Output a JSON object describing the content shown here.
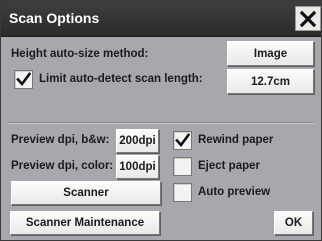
{
  "window": {
    "title": "Scan Options"
  },
  "height_autosize": {
    "label": "Height auto-size method:",
    "value": "Image"
  },
  "limit_scan_length": {
    "label": "Limit auto-detect scan length:",
    "checked": true,
    "value": "12.7cm"
  },
  "preview_dpi_bw": {
    "label": "Preview dpi, b&w:",
    "value": "200dpi"
  },
  "preview_dpi_color": {
    "label": "Preview dpi, color:",
    "value": "100dpi"
  },
  "scanner_button": {
    "label": "Scanner"
  },
  "rewind_paper": {
    "label": "Rewind paper",
    "checked": true
  },
  "eject_paper": {
    "label": "Eject paper",
    "checked": false
  },
  "auto_preview": {
    "label": "Auto preview",
    "checked": false
  },
  "footer": {
    "maintenance_label": "Scanner Maintenance",
    "ok_label": "OK"
  },
  "icons": {
    "close": "close-icon",
    "checkmark": "checkmark-icon"
  }
}
